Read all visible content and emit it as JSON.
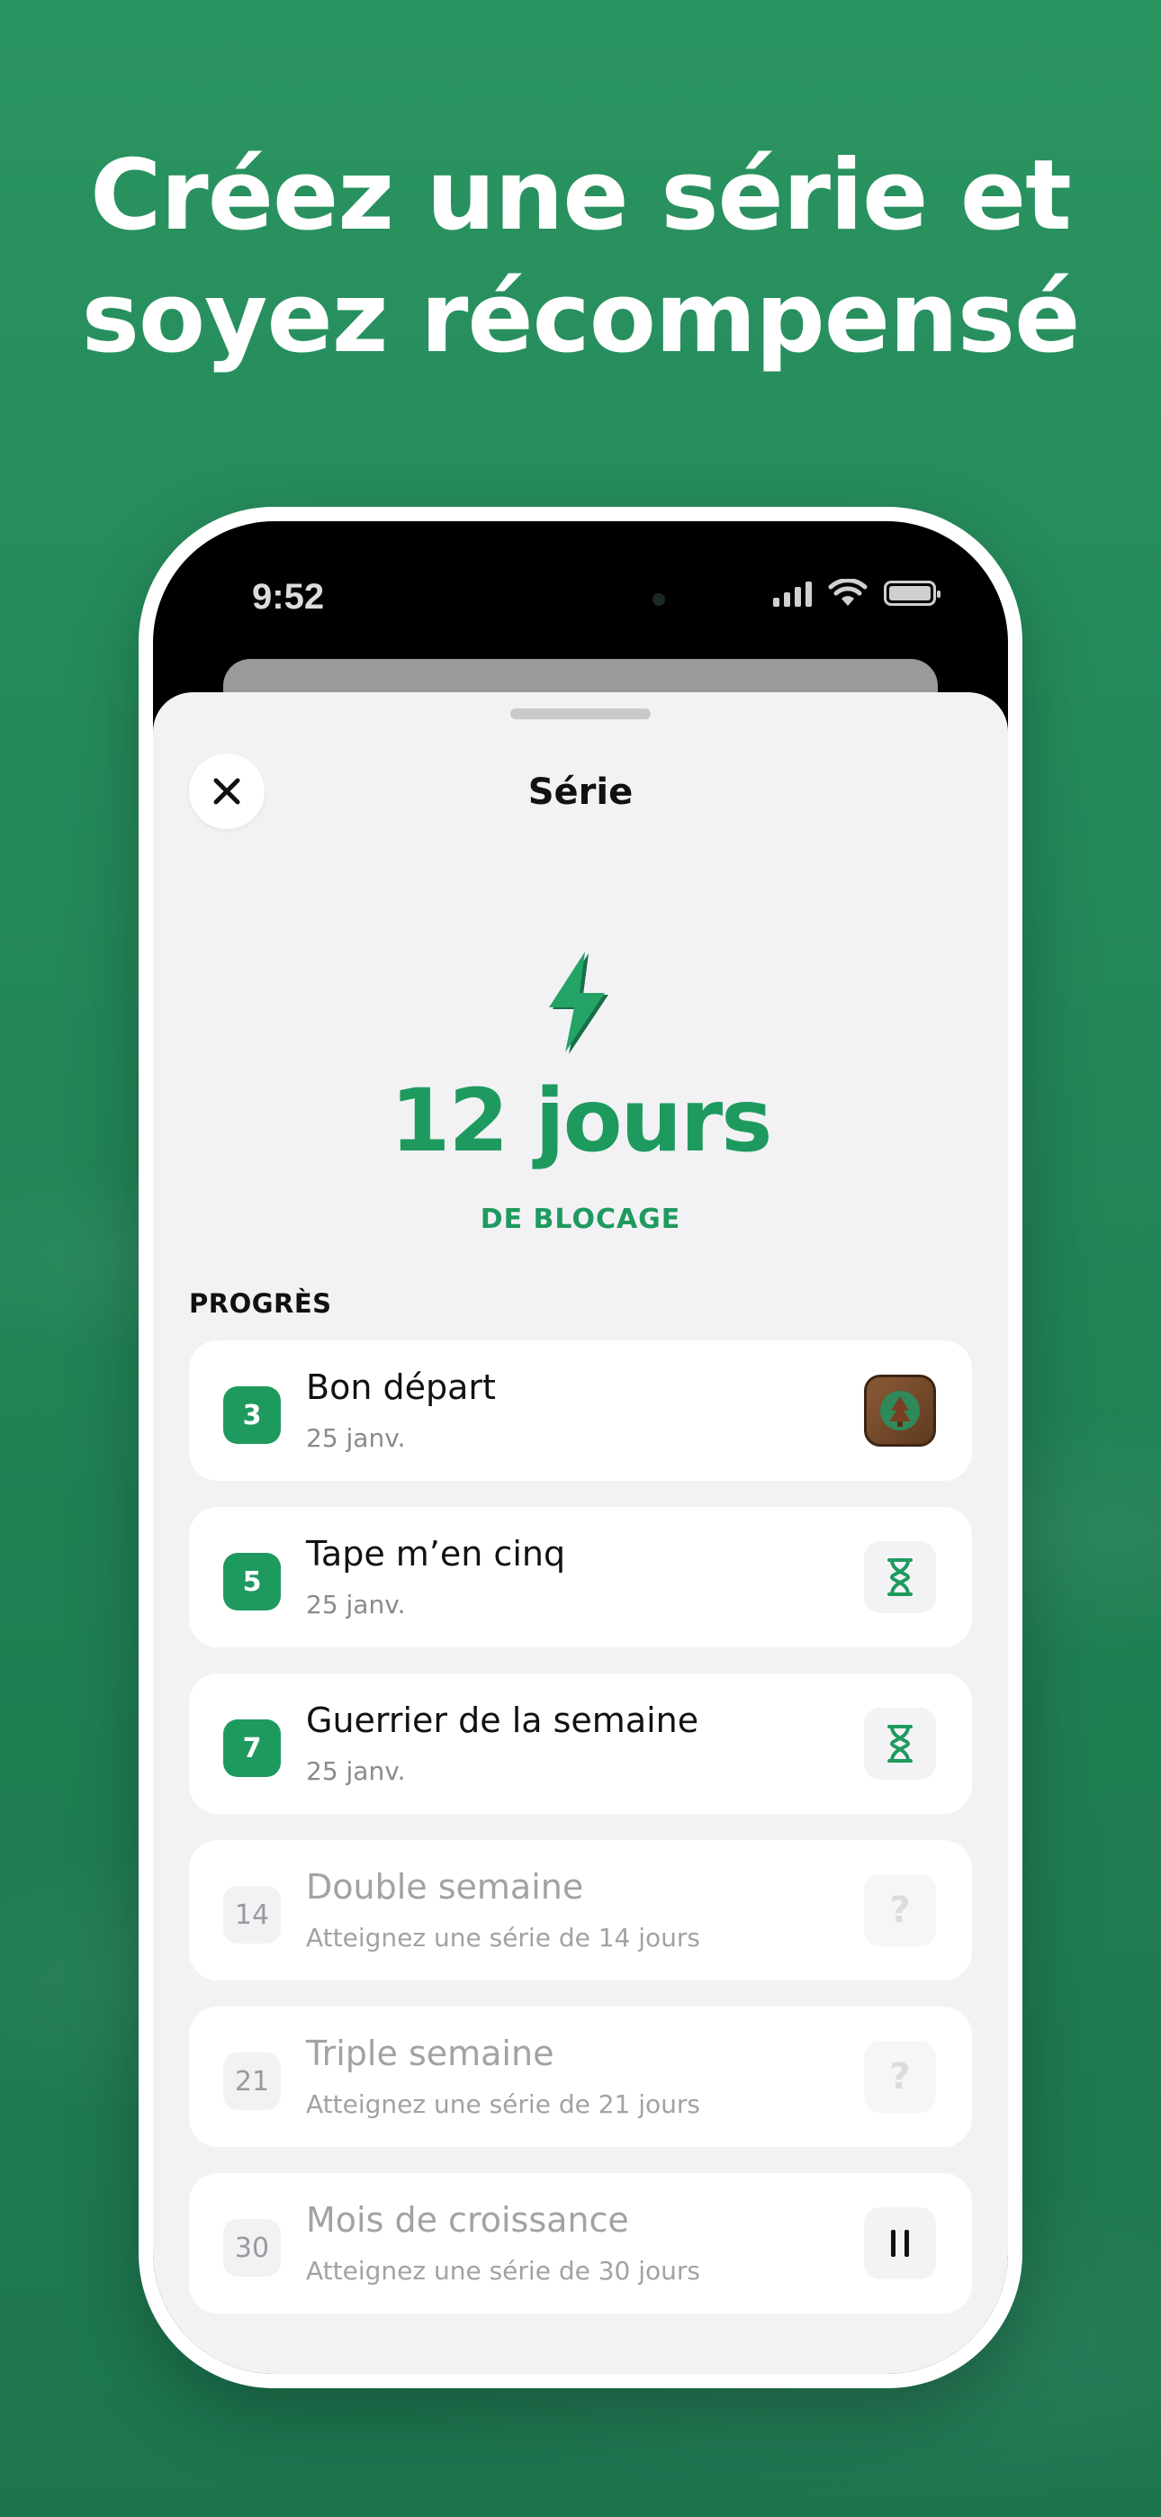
{
  "headline": {
    "line1": "Créez une série et",
    "line2": "soyez récompensé"
  },
  "statusbar": {
    "time": "9:52"
  },
  "sheet": {
    "title": "Série",
    "streak_count": "12 jours",
    "streak_sub": "DE BLOCAGE",
    "section_label": "PROGRÈS"
  },
  "milestones": [
    {
      "badge": "3",
      "title": "Bon départ",
      "sub": "25 janv.",
      "state": "done",
      "icon": "reward-tree-icon"
    },
    {
      "badge": "5",
      "title": "Tape m’en cinq",
      "sub": "25 janv.",
      "state": "done",
      "icon": "hourglass-icon"
    },
    {
      "badge": "7",
      "title": "Guerrier de la semaine",
      "sub": "25 janv.",
      "state": "done",
      "icon": "hourglass-icon"
    },
    {
      "badge": "14",
      "title": "Double semaine",
      "sub": "Atteignez une série de 14 jours",
      "state": "locked",
      "icon": "question-icon",
      "icon_text": "?"
    },
    {
      "badge": "21",
      "title": "Triple semaine",
      "sub": "Atteignez une série de 21 jours",
      "state": "locked",
      "icon": "question-icon",
      "icon_text": "?"
    },
    {
      "badge": "30",
      "title": "Mois de croissance",
      "sub": "Atteignez une série de 30 jours",
      "state": "locked",
      "icon": "pause-icon"
    }
  ],
  "colors": {
    "brand_green": "#1f9a5f",
    "background": "#23885a"
  }
}
